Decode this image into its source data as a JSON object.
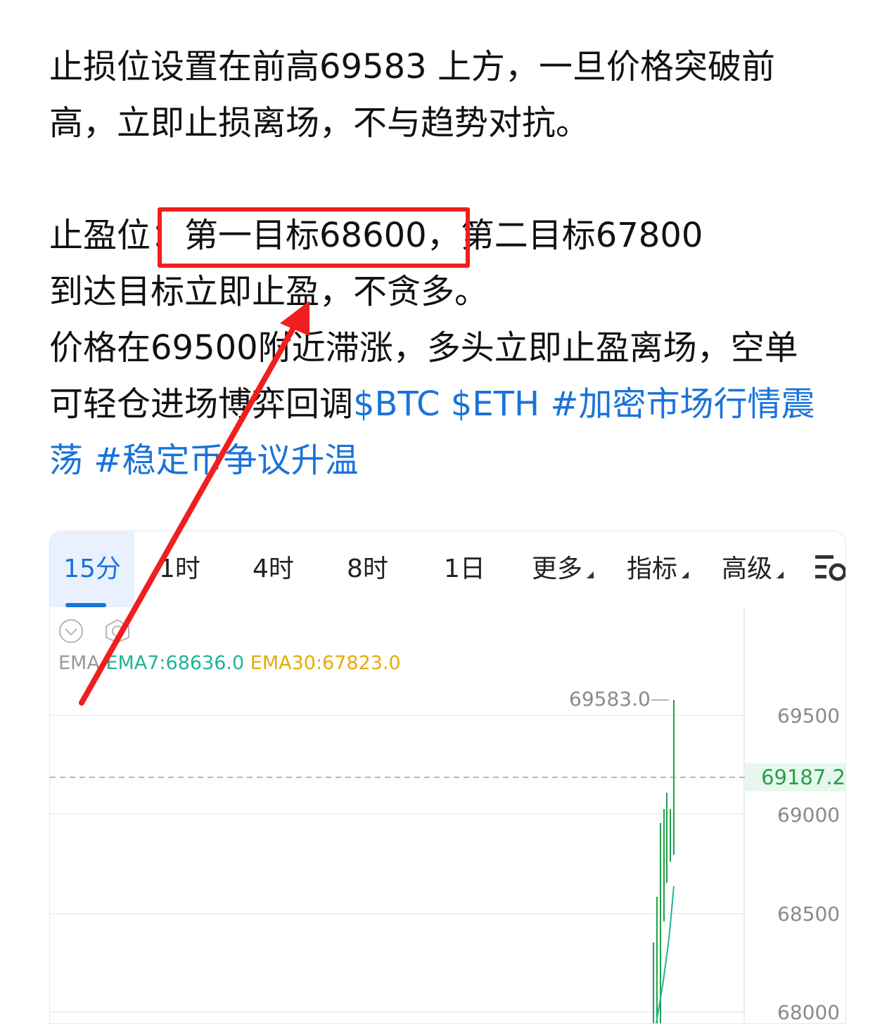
{
  "post": {
    "para1": "止损位设置在前高69583 上方，一旦价格突破前高，立即止损离场，不与趋势对抗。",
    "line_tp": "止盈位：第一目标68600，第二目标67800",
    "line_tp2": "到达目标立即止盈，不贪多。",
    "para3": "价格在69500附近滞涨，多头立即止盈离场，空单可轻仓进场博弈回调",
    "tags": "$BTC $ETH #加密市场行情震荡 #稳定币争议升温"
  },
  "chart": {
    "tabs": [
      "15分",
      "1时",
      "4时",
      "8时",
      "1日",
      "更多",
      "指标",
      "高级"
    ],
    "active_tab": "15分",
    "ema_label": "EMA",
    "ema7": "EMA7:68636.0",
    "ema30": "EMA30:67823.0",
    "high_label": "69583.0",
    "current_price": "69187.2",
    "price_axis": [
      "69500",
      "69000",
      "68500",
      "68000"
    ],
    "colors": {
      "up": "#22a14a",
      "ema7": "#1fb49a",
      "ema30": "#e6ac00",
      "accent": "#1a73d9",
      "annotation": "#f01e1e"
    },
    "icons": [
      "collapse-chevron-icon",
      "snapshot-icon",
      "chart-settings-icon"
    ]
  }
}
